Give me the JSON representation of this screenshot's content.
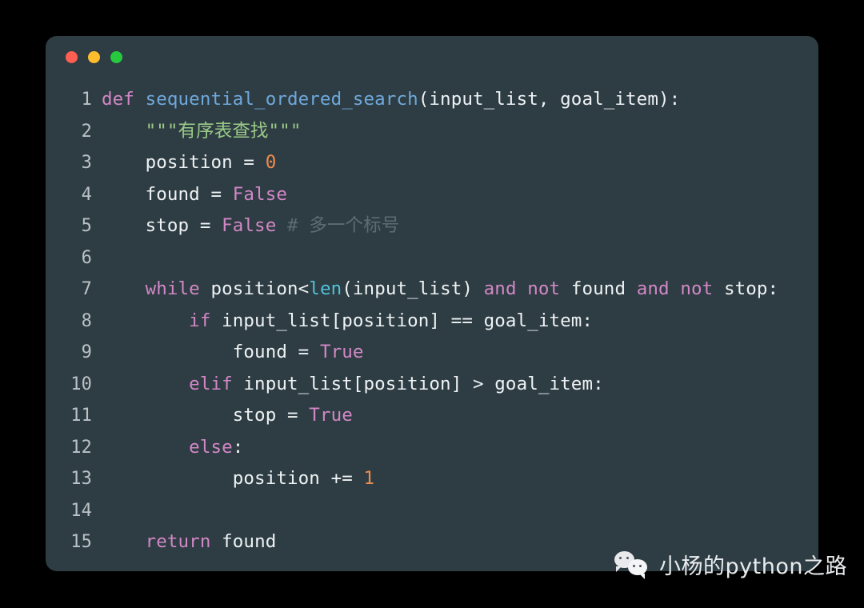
{
  "window": {
    "traffic_lights": [
      {
        "name": "close",
        "color": "#ff5f52"
      },
      {
        "name": "minimize",
        "color": "#ffbd2e"
      },
      {
        "name": "maximize",
        "color": "#27c93f"
      }
    ]
  },
  "colors": {
    "page_background": "#000000",
    "card_background": "#2e3d43",
    "line_number": "#b9c2c6",
    "text": "#eef2f4",
    "keyword": "#d287c6",
    "function": "#6fa8dc",
    "string": "#9bc988",
    "number": "#ef8b4d",
    "comment": "#5c6c73",
    "builtin": "#4fc1d9",
    "watermark_text": "#e9ecee"
  },
  "code": {
    "language": "python",
    "lines": [
      {
        "n": "1",
        "text": "def sequential_ordered_search(input_list, goal_item):"
      },
      {
        "n": "2",
        "text": "    \"\"\"有序表查找\"\"\""
      },
      {
        "n": "3",
        "text": "    position = 0"
      },
      {
        "n": "4",
        "text": "    found = False"
      },
      {
        "n": "5",
        "text": "    stop = False # 多一个标号"
      },
      {
        "n": "6",
        "text": ""
      },
      {
        "n": "7",
        "text": "    while position<len(input_list) and not found and not stop:"
      },
      {
        "n": "8",
        "text": "        if input_list[position] == goal_item:"
      },
      {
        "n": "9",
        "text": "            found = True"
      },
      {
        "n": "10",
        "text": "        elif input_list[position] > goal_item:"
      },
      {
        "n": "11",
        "text": "            stop = True"
      },
      {
        "n": "12",
        "text": "        else:"
      },
      {
        "n": "13",
        "text": "            position += 1"
      },
      {
        "n": "14",
        "text": ""
      },
      {
        "n": "15",
        "text": "    return found"
      }
    ],
    "tokens": [
      [
        {
          "t": "def ",
          "c": "kw"
        },
        {
          "t": "sequential_ordered_search",
          "c": "fn"
        },
        {
          "t": "(input_list, goal_item):",
          "c": "plain"
        }
      ],
      [
        {
          "t": "    ",
          "c": "plain"
        },
        {
          "t": "\"\"\"有序表查找\"\"\"",
          "c": "str"
        }
      ],
      [
        {
          "t": "    position = ",
          "c": "plain"
        },
        {
          "t": "0",
          "c": "num"
        }
      ],
      [
        {
          "t": "    found = ",
          "c": "plain"
        },
        {
          "t": "False",
          "c": "cnst"
        }
      ],
      [
        {
          "t": "    stop = ",
          "c": "plain"
        },
        {
          "t": "False",
          "c": "cnst"
        },
        {
          "t": " ",
          "c": "plain"
        },
        {
          "t": "# 多一个标号",
          "c": "cmt"
        }
      ],
      [
        {
          "t": "",
          "c": "plain"
        }
      ],
      [
        {
          "t": "    ",
          "c": "plain"
        },
        {
          "t": "while",
          "c": "kw"
        },
        {
          "t": " position<",
          "c": "plain"
        },
        {
          "t": "len",
          "c": "bi"
        },
        {
          "t": "(input_list) ",
          "c": "plain"
        },
        {
          "t": "and",
          "c": "kw"
        },
        {
          "t": " ",
          "c": "plain"
        },
        {
          "t": "not",
          "c": "kw"
        },
        {
          "t": " found ",
          "c": "plain"
        },
        {
          "t": "and",
          "c": "kw"
        },
        {
          "t": " ",
          "c": "plain"
        },
        {
          "t": "not",
          "c": "kw"
        },
        {
          "t": " stop:",
          "c": "plain"
        }
      ],
      [
        {
          "t": "        ",
          "c": "plain"
        },
        {
          "t": "if",
          "c": "kw"
        },
        {
          "t": " input_list[position] == goal_item:",
          "c": "plain"
        }
      ],
      [
        {
          "t": "            found = ",
          "c": "plain"
        },
        {
          "t": "True",
          "c": "cnst"
        }
      ],
      [
        {
          "t": "        ",
          "c": "plain"
        },
        {
          "t": "elif",
          "c": "kw"
        },
        {
          "t": " input_list[position] > goal_item:",
          "c": "plain"
        }
      ],
      [
        {
          "t": "            stop = ",
          "c": "plain"
        },
        {
          "t": "True",
          "c": "cnst"
        }
      ],
      [
        {
          "t": "        ",
          "c": "plain"
        },
        {
          "t": "else",
          "c": "kw"
        },
        {
          "t": ":",
          "c": "plain"
        }
      ],
      [
        {
          "t": "            position += ",
          "c": "plain"
        },
        {
          "t": "1",
          "c": "num"
        }
      ],
      [
        {
          "t": "",
          "c": "plain"
        }
      ],
      [
        {
          "t": "    ",
          "c": "plain"
        },
        {
          "t": "return",
          "c": "kw"
        },
        {
          "t": " found",
          "c": "plain"
        }
      ]
    ]
  },
  "watermark": {
    "icon": "wechat-icon",
    "text": "小杨的python之路"
  }
}
